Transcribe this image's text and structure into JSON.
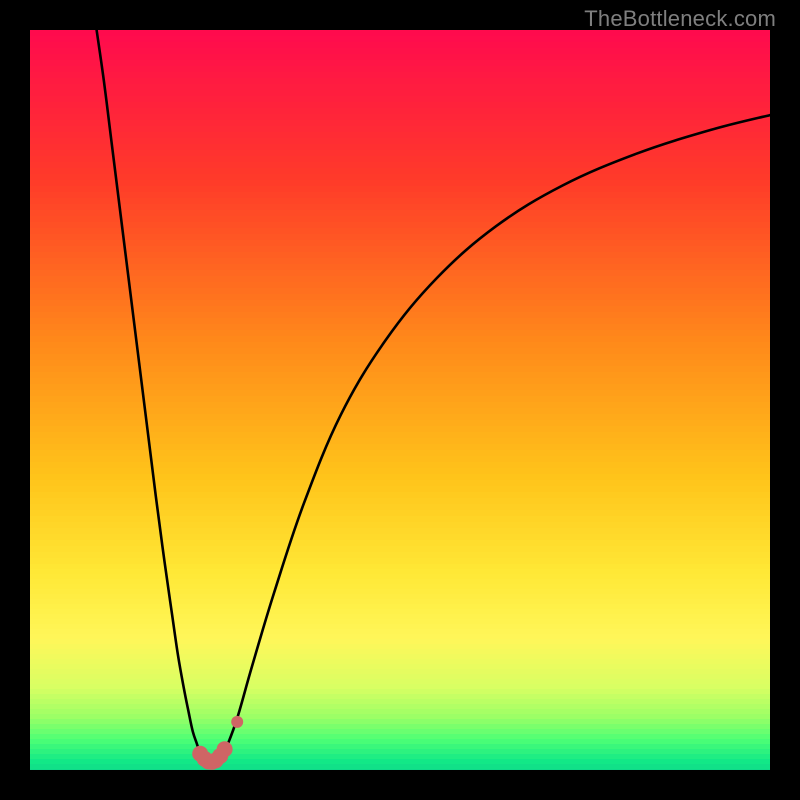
{
  "watermark": {
    "text": "TheBottleneck.com"
  },
  "chart_data": {
    "type": "line",
    "title": "",
    "xlabel": "",
    "ylabel": "",
    "xlim": [
      0,
      100
    ],
    "ylim": [
      0,
      100
    ],
    "grid": false,
    "legend": false,
    "gradient_stops": [
      {
        "pos": 0.0,
        "color": "#ff0b4d"
      },
      {
        "pos": 0.2,
        "color": "#ff3b29"
      },
      {
        "pos": 0.42,
        "color": "#ff8a1a"
      },
      {
        "pos": 0.6,
        "color": "#ffc41a"
      },
      {
        "pos": 0.73,
        "color": "#ffe836"
      },
      {
        "pos": 0.82,
        "color": "#fff75a"
      },
      {
        "pos": 0.885,
        "color": "#d8ff63"
      },
      {
        "pos": 0.925,
        "color": "#9bff66"
      },
      {
        "pos": 0.955,
        "color": "#4eff75"
      },
      {
        "pos": 0.985,
        "color": "#12e887"
      },
      {
        "pos": 1.0,
        "color": "#0fd98a"
      }
    ],
    "series": [
      {
        "name": "left-branch",
        "description": "steep descending curve from upper-left into the dip",
        "x": [
          9,
          10,
          11,
          12.5,
          14,
          15.5,
          17,
          18.2,
          19.2,
          20,
          20.8,
          21.4,
          22,
          22.6,
          23
        ],
        "y": [
          100,
          93,
          85,
          73,
          61,
          49,
          37,
          28,
          21,
          15.5,
          11,
          8,
          5.2,
          3.4,
          2.0
        ]
      },
      {
        "name": "dip",
        "description": "rounded bottom between the two branches",
        "x": [
          23,
          23.5,
          24,
          24.5,
          25,
          25.5,
          26,
          26.5
        ],
        "y": [
          2.0,
          1.3,
          1.05,
          1.0,
          1.1,
          1.4,
          2.0,
          2.9
        ]
      },
      {
        "name": "right-branch",
        "description": "rising curve from the dip, flattening toward upper-right",
        "x": [
          26.5,
          28,
          30,
          33,
          37,
          42,
          48,
          55,
          63,
          72,
          82,
          92,
          100
        ],
        "y": [
          2.9,
          7,
          14,
          24,
          36,
          48,
          58,
          66.5,
          73.5,
          79,
          83.3,
          86.5,
          88.5
        ]
      }
    ],
    "markers": {
      "name": "highlighted-points",
      "color": "#cf6565",
      "points": [
        {
          "x": 23.0,
          "y": 2.2,
          "r": 8
        },
        {
          "x": 23.6,
          "y": 1.5,
          "r": 8
        },
        {
          "x": 24.1,
          "y": 1.15,
          "r": 8
        },
        {
          "x": 24.6,
          "y": 1.1,
          "r": 8
        },
        {
          "x": 25.1,
          "y": 1.3,
          "r": 8
        },
        {
          "x": 25.7,
          "y": 1.9,
          "r": 8
        },
        {
          "x": 26.3,
          "y": 2.8,
          "r": 8
        },
        {
          "x": 28.0,
          "y": 6.5,
          "r": 6
        }
      ]
    }
  }
}
